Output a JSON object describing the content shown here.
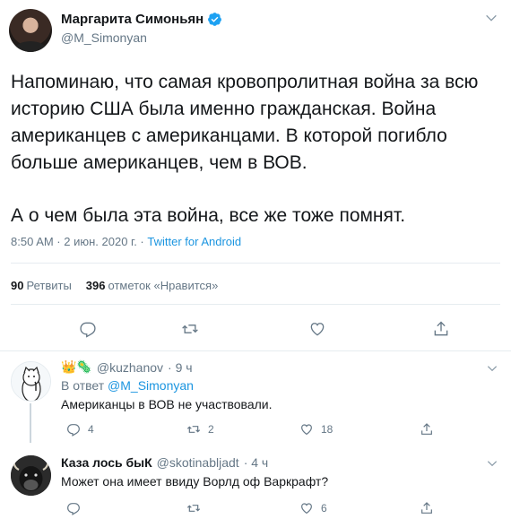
{
  "main_tweet": {
    "author_name": "Маргарита Симоньян",
    "handle": "@M_Simonyan",
    "text_paragraph_1": "Напоминаю, что самая кровопролитная война за всю историю США была именно гражданская. Война американцев с американцами. В которой погибло больше американцев, чем в ВОВ.",
    "text_paragraph_2": "А о чем была эта война, все же тоже помнят.",
    "timestamp": "8:50 AM · 2 июн. 2020 г. · ",
    "source_app": "Twitter for Android",
    "retweets_count": "90",
    "retweets_label": "Ретвиты",
    "likes_count": "396",
    "likes_label": "отметок «Нравится»"
  },
  "replies": [
    {
      "emoji_prefix": "👑🦠",
      "handle": "@kuzhanov",
      "time": "· 9 ч",
      "reply_to_prefix": "В ответ",
      "reply_to_mention": "@M_Simonyan",
      "text": "Американцы в ВОВ не участвовали.",
      "reply_count": "4",
      "retweet_count": "2",
      "like_count": "18"
    },
    {
      "author_name": "Каза лось быК",
      "handle": "@skotinabljadt",
      "time": "· 4 ч",
      "text": "Может она имеет ввиду Ворлд оф Варкрафт?",
      "like_count": "6"
    }
  ],
  "icons": {
    "verified": "verified-badge-icon",
    "caret": "chevron-down-icon",
    "reply": "reply-icon",
    "retweet": "retweet-icon",
    "like": "heart-icon",
    "share": "share-icon"
  },
  "colors": {
    "link": "#1b95e0",
    "secondary_text": "#657786",
    "primary_text": "#14171a",
    "verified": "#1da1f2"
  }
}
